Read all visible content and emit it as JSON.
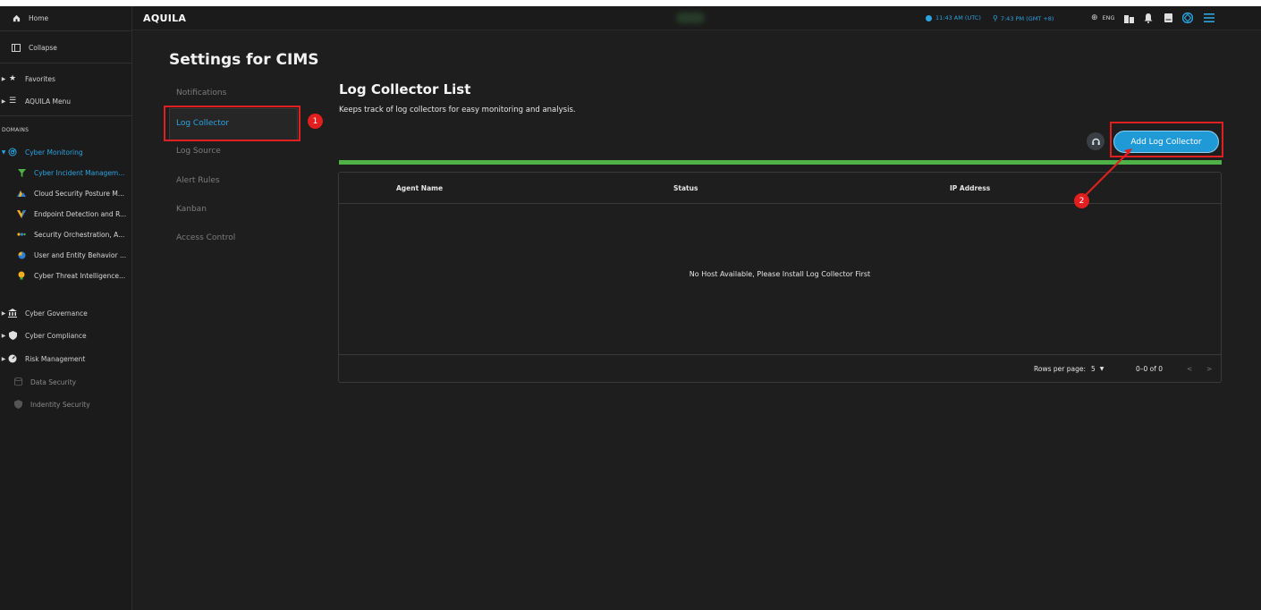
{
  "sidebar": {
    "home": "Home",
    "collapse": "Collapse",
    "favorites": "Favorites",
    "aquila_menu": "AQUILA Menu",
    "domains_label": "DOMAINS",
    "items": [
      {
        "label": "Cyber Monitoring",
        "icon": "radar-icon"
      },
      {
        "label": "Cyber Incident Managem...",
        "icon": "funnel-icon"
      },
      {
        "label": "Cloud Security Posture M...",
        "icon": "mountain-icon"
      },
      {
        "label": "Endpoint Detection and R...",
        "icon": "v-shape-icon"
      },
      {
        "label": "Security Orchestration, A...",
        "icon": "dots-icon"
      },
      {
        "label": "User and Entity Behavior ...",
        "icon": "pie-icon"
      },
      {
        "label": "Cyber Threat Intelligence...",
        "icon": "bulb-icon"
      },
      {
        "label": "Cyber Governance",
        "icon": "bank-icon"
      },
      {
        "label": "Cyber Compliance",
        "icon": "shield-icon"
      },
      {
        "label": "Risk Management",
        "icon": "gauge-icon"
      },
      {
        "label": "Data Security",
        "icon": "database-icon"
      },
      {
        "label": "Indentity Security",
        "icon": "id-shield-icon"
      }
    ]
  },
  "topbar": {
    "logo": "AQUILA",
    "time_utc": "11:43 AM (UTC)",
    "time_local": "7:43 PM (GMT +8)",
    "language": "ENG"
  },
  "settings": {
    "title": "Settings for CIMS",
    "nav": [
      "Notifications",
      "Log Collector",
      "Log Source",
      "Alert Rules",
      "Kanban",
      "Access Control"
    ],
    "active_index": 1
  },
  "main": {
    "title": "Log Collector List",
    "subtitle": "Keeps track of log collectors for easy monitoring and analysis.",
    "add_button": "Add Log Collector",
    "progress_percent": 100,
    "table": {
      "headers": [
        "Agent Name",
        "Status",
        "IP Address"
      ],
      "empty_message": "No Host Available, Please Install Log Collector First"
    },
    "pagination": {
      "rows_label": "Rows per page:",
      "rows_value": "5",
      "range": "0–0 of 0"
    }
  },
  "annotations": [
    "1",
    "2"
  ],
  "colors": {
    "accent": "#2ba4e0",
    "progress": "#4fb246",
    "annotation": "#e02020"
  }
}
